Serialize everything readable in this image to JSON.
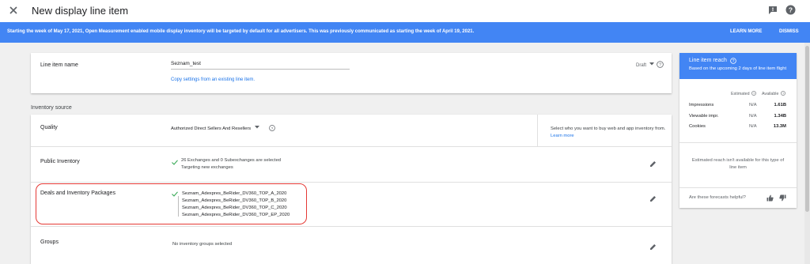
{
  "header": {
    "title": "New display line item",
    "close_icon": "close-icon",
    "feedback_icon": "feedback-icon",
    "help_icon": "help-circle-icon"
  },
  "banner": {
    "message": "Starting the week of May 17, 2021, Open Measurement enabled mobile display inventory will be targeted by default for all advertisers. This was previously communicated as starting the week of April 19, 2021.",
    "learn_more": "LEARN MORE",
    "dismiss": "DISMISS",
    "color": "#4285f4"
  },
  "line_item": {
    "label": "Line item name",
    "value": "Seznam_test",
    "copy_link": "Copy settings from an existing line item.",
    "status": "Draft"
  },
  "inventory": {
    "section_title": "Inventory source",
    "quality": {
      "label": "Quality",
      "selected": "Authorized Direct Sellers And Resellers",
      "info_text": "Select who you want to buy web and app inventory from.",
      "info_link": "Learn more"
    },
    "public": {
      "label": "Public Inventory",
      "summary": "26 Exchanges and 0 Subexchanges are selected",
      "detail": "Targeting new exchanges"
    },
    "deals": {
      "label": "Deals and Inventory Packages",
      "packages": [
        "Seznam_Adexpres_BeRider_DV360_TOP_A_2020",
        "Seznam_Adexpres_BeRider_DV360_TOP_B_2020",
        "Seznam_Adexpres_BeRider_DV360_TOP_C_2020",
        "Seznam_Adexpres_BeRider_DV360_TOP_EP_2020"
      ]
    },
    "groups": {
      "label": "Groups",
      "summary": "No inventory groups selected"
    }
  },
  "reach": {
    "title": "Line item reach",
    "subtitle": "Based on the upcoming 2 days of line item flight",
    "col_estimated": "Estimated",
    "col_available": "Available",
    "metrics": [
      {
        "label": "Impressions",
        "estimated": "N/A",
        "available": "1.61B"
      },
      {
        "label": "Viewable impr.",
        "estimated": "N/A",
        "available": "1.34B"
      },
      {
        "label": "Cookies",
        "estimated": "N/A",
        "available": "13.3M"
      }
    ],
    "note": "Estimated reach isn't available for this type of line item",
    "feedback_question": "Are these forecasts helpful?"
  },
  "colors": {
    "primary_blue": "#4285f4",
    "link_blue": "#1a73e8",
    "check_green": "#34a853",
    "highlight_red": "#e53935"
  }
}
